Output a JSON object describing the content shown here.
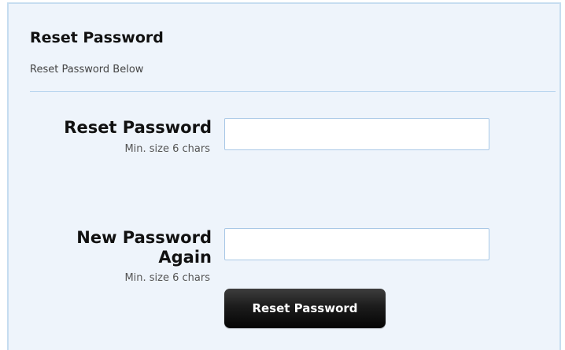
{
  "header": {
    "title": "Reset Password",
    "subtitle": "Reset Password Below"
  },
  "form": {
    "password": {
      "label": "Reset Password",
      "hint": "Min. size 6 chars",
      "value": ""
    },
    "password_again": {
      "label_line1": "New Password",
      "label_line2": "Again",
      "hint": "Min. size 6 chars",
      "value": ""
    },
    "submit_label": "Reset Password"
  },
  "colors": {
    "panel_background": "#eef4fb",
    "panel_border": "#c6ddf0",
    "button_background": "#1c1c1c",
    "button_text": "#ffffff"
  }
}
